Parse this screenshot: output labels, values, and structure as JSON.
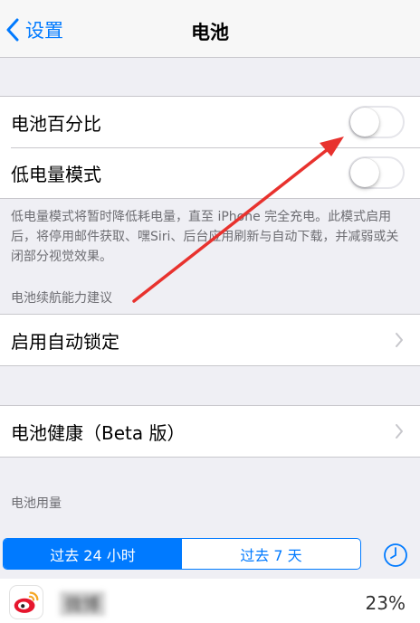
{
  "navbar": {
    "back_label": "设置",
    "title": "电池"
  },
  "settings": {
    "battery_percentage": {
      "label": "电池百分比",
      "on": false
    },
    "low_power_mode": {
      "label": "低电量模式",
      "on": false
    },
    "low_power_footnote": "低电量模式将暂时降低耗电量，直至 iPhone 完全充电。此模式启用后，将停用邮件获取、嘿Siri、后台应用刷新与自动下载，并减弱或关闭部分视觉效果。",
    "suggestions_header": "电池续航能力建议",
    "auto_lock": {
      "label": "启用自动锁定"
    },
    "battery_health": {
      "label": "电池健康（Beta 版）"
    },
    "usage_header": "电池用量"
  },
  "usage": {
    "segments": [
      {
        "label": "过去 24 小时",
        "selected": true
      },
      {
        "label": "过去 7 天",
        "selected": false
      }
    ],
    "apps": [
      {
        "name": "微博",
        "percent": "23%",
        "icon": "weibo-icon"
      }
    ]
  },
  "colors": {
    "accent": "#007aff",
    "background": "#efeff4",
    "annotation_arrow": "#e8322e",
    "weibo_red": "#e6162d",
    "weibo_yellow": "#f5a623"
  }
}
